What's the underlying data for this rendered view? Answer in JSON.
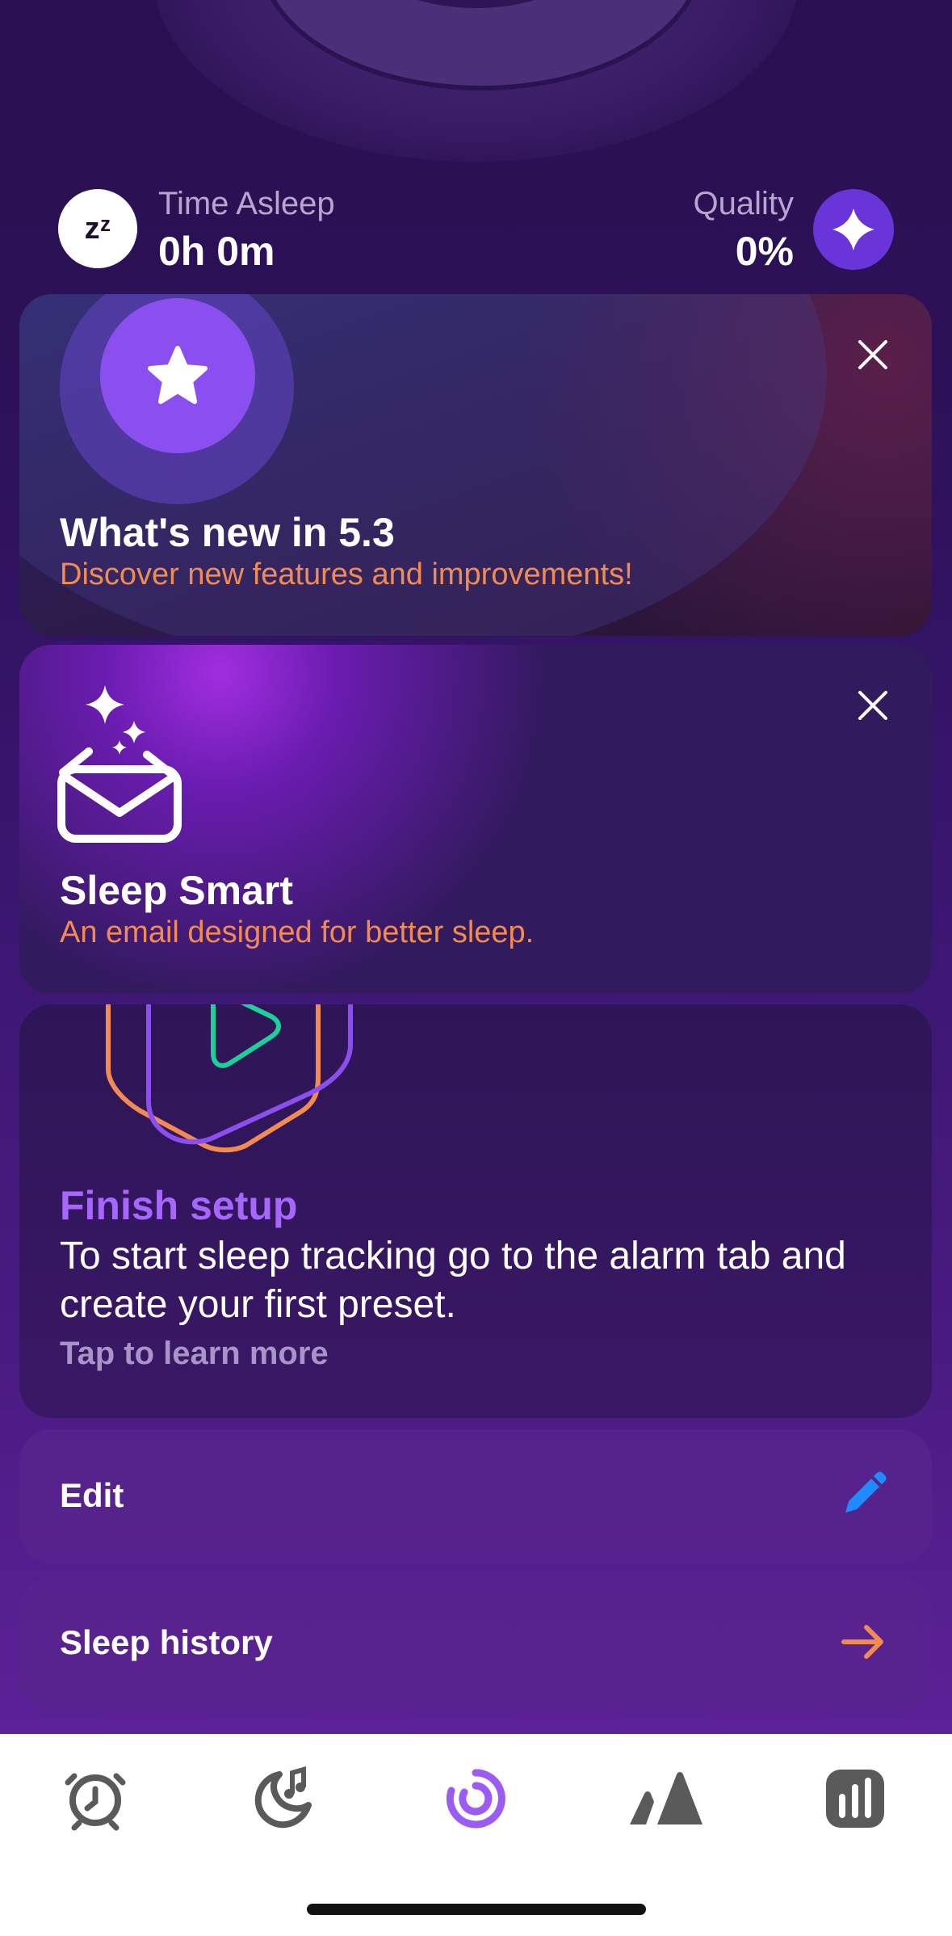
{
  "stats": {
    "time_asleep_label": "Time Asleep",
    "time_asleep_value": "0h 0m",
    "quality_label": "Quality",
    "quality_value": "0%",
    "zz_icon_text": "zᶻ"
  },
  "cards": {
    "whats_new": {
      "title": "What's new in 5.3",
      "subtitle": "Discover new features and improvements!",
      "icon": "star-icon"
    },
    "sleep_smart": {
      "title": "Sleep Smart",
      "subtitle": "An email designed for better sleep.",
      "icon": "envelope-sparkle-icon"
    },
    "finish_setup": {
      "title": "Finish setup",
      "body": "To start sleep tracking go to the alarm tab and create your first preset.",
      "link": "Tap to learn more"
    }
  },
  "rows": {
    "edit_label": "Edit",
    "history_label": "Sleep history"
  },
  "tabbar": [
    "alarm-icon",
    "sleep-sounds-icon",
    "tracking-icon",
    "mountain-icon",
    "stats-icon"
  ],
  "colors": {
    "accent_orange": "#f28b52",
    "accent_purple": "#a667ff",
    "edit_blue": "#1e8cff",
    "active_tab": "#9b5cf6",
    "inactive_tab": "#5a5a5a"
  }
}
